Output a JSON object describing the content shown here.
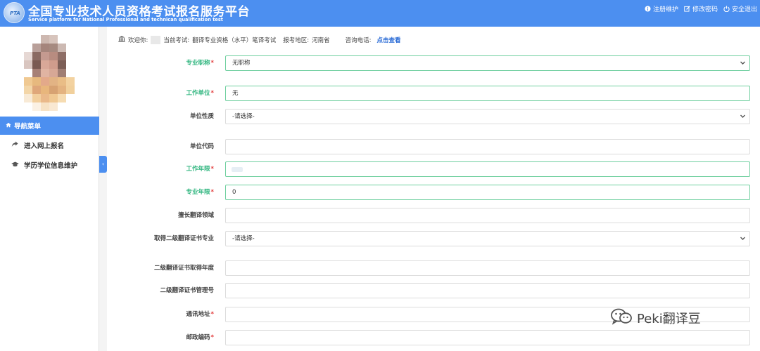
{
  "header": {
    "logo_text": "PTA",
    "title": "全国专业技术人员资格考试报名服务平台",
    "subtitle": "Service platform for National Professional and technican qualification test",
    "links": [
      {
        "icon": "info-icon",
        "label": "注册维护"
      },
      {
        "icon": "edit-icon",
        "label": "修改密码"
      },
      {
        "icon": "power-icon",
        "label": "安全退出"
      }
    ]
  },
  "sidebar": {
    "nav_header": "导航菜单",
    "items": [
      {
        "icon": "share-arrow-icon",
        "label": "进入网上报名"
      },
      {
        "icon": "graduation-cap-icon",
        "label": "学历学位信息维护"
      }
    ],
    "collapse_symbol": "‹"
  },
  "info_bar": {
    "welcome": "欢迎你:",
    "exam_label": "当前考试:",
    "exam_value": "翻译专业资格（水平）笔译考试",
    "region_label": "报考地区:",
    "region_value": "河南省",
    "phone_label": "咨询电话:",
    "phone_link": "点击查看"
  },
  "form": {
    "fields": [
      {
        "label": "专业职称",
        "required": true,
        "type": "select",
        "value": "无职称",
        "highlight": true
      },
      {
        "label": "工作单位",
        "required": true,
        "type": "input",
        "value": "无",
        "highlight": true
      },
      {
        "label": "单位性质",
        "required": false,
        "type": "select",
        "value": "-请选择-",
        "highlight": false
      },
      {
        "label": "单位代码",
        "required": false,
        "type": "input",
        "value": "",
        "highlight": false
      },
      {
        "label": "工作年限",
        "required": true,
        "type": "input",
        "value": "",
        "highlight": true
      },
      {
        "label": "专业年限",
        "required": true,
        "type": "input",
        "value": "0",
        "highlight": true
      },
      {
        "label": "擅长翻译领域",
        "required": false,
        "type": "input",
        "value": "",
        "highlight": false
      },
      {
        "label": "取得二级翻译证书专业",
        "required": false,
        "type": "select",
        "value": "-请选择-",
        "highlight": false
      },
      {
        "label": "二级翻译证书取得年度",
        "required": false,
        "type": "input",
        "value": "",
        "highlight": false
      },
      {
        "label": "二级翻译证书管理号",
        "required": false,
        "type": "input",
        "value": "",
        "highlight": false
      },
      {
        "label": "通讯地址",
        "required": true,
        "type": "input",
        "value": "",
        "highlight": false
      },
      {
        "label": "邮政编码",
        "required": true,
        "type": "input",
        "value": "",
        "highlight": false
      }
    ]
  },
  "watermark": {
    "text": "Peki翻译豆"
  }
}
